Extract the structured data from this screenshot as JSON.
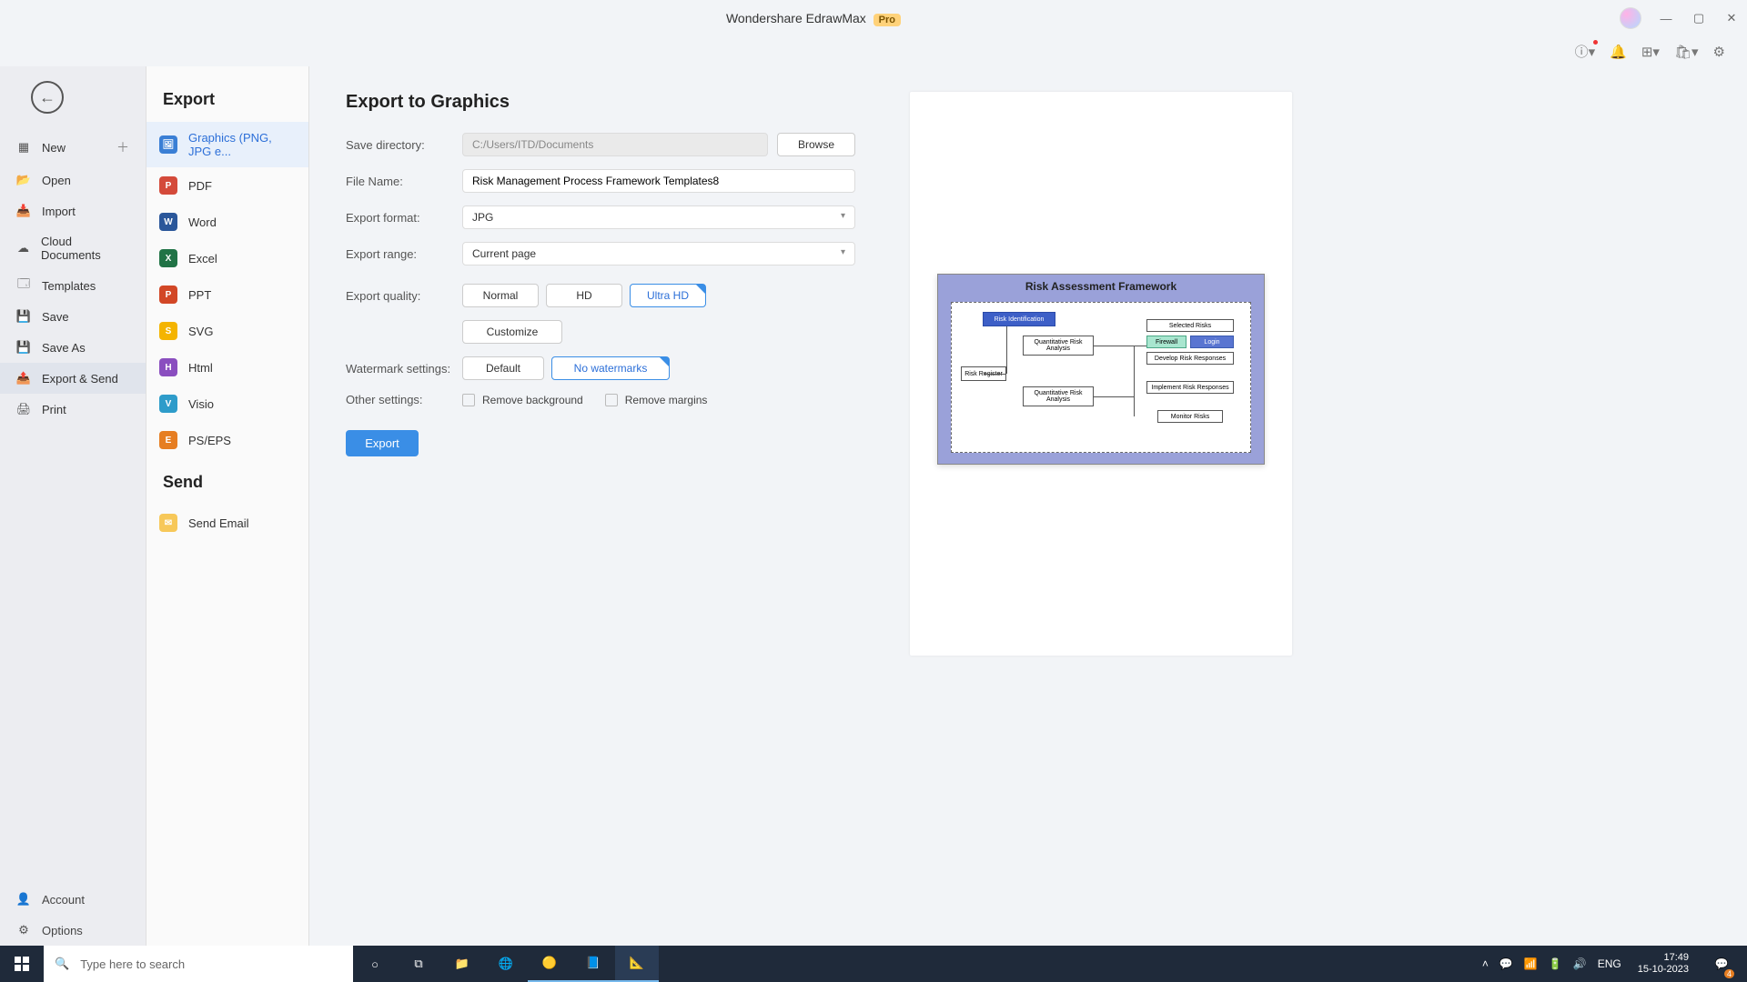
{
  "titlebar": {
    "app_name": "Wondershare EdrawMax",
    "badge": "Pro"
  },
  "toolbar": {
    "help": "?",
    "bell": "🔔",
    "apps": "⊞",
    "cart": "🛍",
    "gear": "⚙"
  },
  "sidebar_left": {
    "items": [
      {
        "label": "New",
        "icon": "＋",
        "has_plus": true
      },
      {
        "label": "Open",
        "icon": "📂"
      },
      {
        "label": "Import",
        "icon": "📥"
      },
      {
        "label": "Cloud Documents",
        "icon": "☁"
      },
      {
        "label": "Templates",
        "icon": "🗔"
      },
      {
        "label": "Save",
        "icon": "💾"
      },
      {
        "label": "Save As",
        "icon": "💾"
      },
      {
        "label": "Export & Send",
        "icon": "📤",
        "active": true
      },
      {
        "label": "Print",
        "icon": "🖨"
      }
    ],
    "bottom": [
      {
        "label": "Account",
        "icon": "👤"
      },
      {
        "label": "Options",
        "icon": "⚙"
      }
    ]
  },
  "sidebar_mid": {
    "heading_export": "Export",
    "heading_send": "Send",
    "formats": [
      {
        "label": "Graphics (PNG, JPG e...",
        "short": "G",
        "cls": "c-blue",
        "active": true
      },
      {
        "label": "PDF",
        "short": "P",
        "cls": "c-red"
      },
      {
        "label": "Word",
        "short": "W",
        "cls": "c-dblue"
      },
      {
        "label": "Excel",
        "short": "X",
        "cls": "c-green"
      },
      {
        "label": "PPT",
        "short": "P",
        "cls": "c-orange"
      },
      {
        "label": "SVG",
        "short": "S",
        "cls": "c-yellow"
      },
      {
        "label": "Html",
        "short": "H",
        "cls": "c-purple"
      },
      {
        "label": "Visio",
        "short": "V",
        "cls": "c-teal"
      },
      {
        "label": "PS/EPS",
        "short": "E",
        "cls": "c-dorange"
      }
    ],
    "send": [
      {
        "label": "Send Email",
        "short": "✉",
        "cls": "c-mail"
      }
    ]
  },
  "form": {
    "title": "Export to Graphics",
    "labels": {
      "save_dir": "Save directory:",
      "file_name": "File Name:",
      "format": "Export format:",
      "range": "Export range:",
      "quality": "Export quality:",
      "watermark": "Watermark settings:",
      "other": "Other settings:"
    },
    "values": {
      "save_dir": "C:/Users/ITD/Documents",
      "file_name": "Risk Management Process Framework Templates8",
      "format": "JPG",
      "range": "Current page"
    },
    "browse": "Browse",
    "quality": {
      "normal": "Normal",
      "hd": "HD",
      "uhd": "Ultra HD"
    },
    "customize": "Customize",
    "watermark": {
      "default": "Default",
      "none": "No watermarks"
    },
    "other": {
      "remove_bg": "Remove background",
      "remove_margins": "Remove margins"
    },
    "export_btn": "Export"
  },
  "preview": {
    "title": "Risk Assessment Framework",
    "boxes": {
      "risk_id": "Risk Identification",
      "quant1": "Quantitative Risk Analysis",
      "risk_reg": "Risk Register",
      "quant2": "Quantitative Risk Analysis",
      "selected": "Selected Risks",
      "firewall": "Firewall",
      "login": "Login",
      "develop": "Develop Risk Responses",
      "impl": "Implement Risk Responses",
      "monitor": "Monitor Risks"
    }
  },
  "taskbar": {
    "search_placeholder": "Type here to search",
    "lang": "ENG",
    "time": "17:49",
    "date": "15-10-2023",
    "notif_count": "4"
  }
}
